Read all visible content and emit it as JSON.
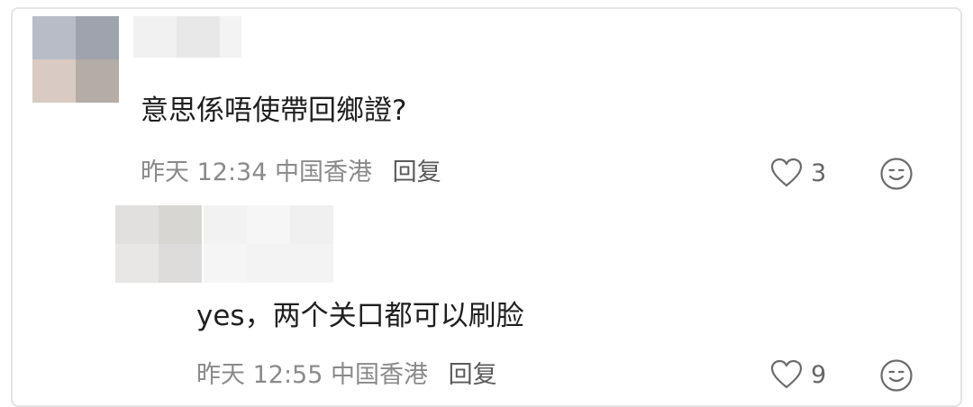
{
  "comment": {
    "text": "意思係唔使帶回鄉證?",
    "time": "昨天 12:34",
    "location": "中国香港",
    "reply_label": "回复",
    "like_count": "3",
    "like_icon": "heart-outline-icon",
    "emoji_icon": "smiley-face-icon"
  },
  "reply": {
    "text": "yes，两个关口都可以刷脸",
    "time": "昨天 12:55",
    "location": "中国香港",
    "reply_label": "回复",
    "like_count": "9",
    "like_icon": "heart-outline-icon",
    "emoji_icon": "smiley-face-icon"
  },
  "colors": {
    "text": "#1f1f1f",
    "meta": "#8a8a8a",
    "icon": "#6b6b6b",
    "border": "#e4e4e4"
  }
}
